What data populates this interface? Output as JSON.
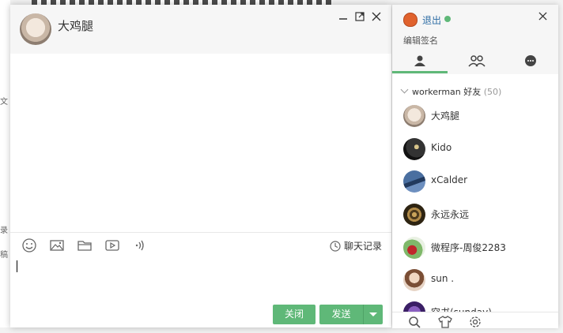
{
  "chat": {
    "contact_name": "大鸡腿",
    "history_label": "聊天记录",
    "close_label": "关闭",
    "send_label": "发送",
    "window_controls": [
      "minimize-icon",
      "maximize-icon",
      "close-icon"
    ],
    "tools": [
      "emoji-icon",
      "image-icon",
      "folder-icon",
      "video-icon",
      "audio-icon"
    ]
  },
  "panel": {
    "logout_label": "退出",
    "signature_label": "编辑签名",
    "tabs": [
      "friends-icon",
      "group-icon",
      "chat-history-icon"
    ],
    "group": {
      "name": "workerman 好友",
      "count": "(50)"
    },
    "friends": [
      {
        "name": "大鸡腿"
      },
      {
        "name": "Kido"
      },
      {
        "name": "xCalder"
      },
      {
        "name": "永远永远"
      },
      {
        "name": "微程序-周俊2283"
      },
      {
        "name": "sun ."
      },
      {
        "name": "空书(sunday)"
      }
    ],
    "footer": [
      "search-icon",
      "skin-icon",
      "settings-icon"
    ]
  },
  "colors": {
    "accent": "#5fb878",
    "link": "#2e6da4",
    "me_avatar": "#e0622d"
  }
}
